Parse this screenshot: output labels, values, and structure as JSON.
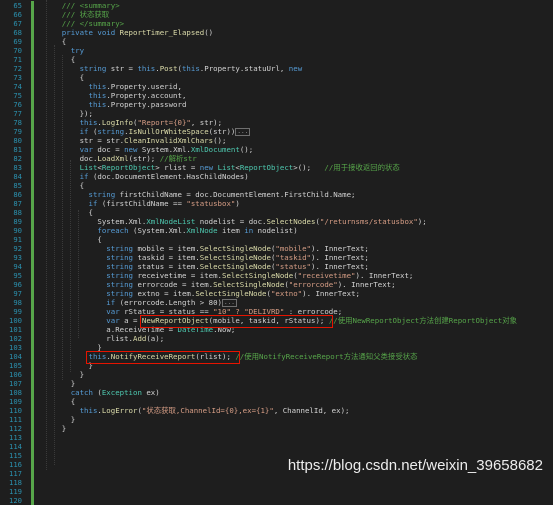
{
  "lines": [
    {
      "n": "65",
      "segs": [
        [
          "cm",
          "/// <summary>"
        ]
      ]
    },
    {
      "n": "66",
      "segs": [
        [
          "cm",
          "/// 状态获取"
        ]
      ]
    },
    {
      "n": "67",
      "segs": [
        [
          "cm",
          "/// </summary>"
        ]
      ]
    },
    {
      "n": "68",
      "segs": [
        [
          "kw",
          "private void "
        ],
        [
          "fn",
          "ReportTimer_Elapsed"
        ],
        [
          "pl",
          "()"
        ]
      ]
    },
    {
      "n": "69",
      "segs": [
        [
          "pl",
          "{"
        ]
      ]
    },
    {
      "n": "70",
      "segs": [
        [
          "kw",
          "try"
        ]
      ]
    },
    {
      "n": "71",
      "segs": [
        [
          "pl",
          "{"
        ]
      ]
    },
    {
      "n": "72",
      "segs": [
        [
          "kw",
          "string "
        ],
        [
          "pl",
          "str = "
        ],
        [
          "kw",
          "this"
        ],
        [
          "pl",
          "."
        ],
        [
          "fn",
          "Post"
        ],
        [
          "pl",
          "("
        ],
        [
          "kw",
          "this"
        ],
        [
          "pl",
          ".Property.statuUrl, "
        ],
        [
          "kw",
          "new"
        ]
      ]
    },
    {
      "n": "73",
      "segs": [
        [
          "pl",
          "{"
        ]
      ]
    },
    {
      "n": "74",
      "segs": [
        [
          "kw",
          "this"
        ],
        [
          "pl",
          ".Property.userid,"
        ]
      ]
    },
    {
      "n": "75",
      "segs": [
        [
          "kw",
          "this"
        ],
        [
          "pl",
          ".Property.account,"
        ]
      ]
    },
    {
      "n": "76",
      "segs": [
        [
          "kw",
          "this"
        ],
        [
          "pl",
          ".Property.password"
        ]
      ]
    },
    {
      "n": "77",
      "segs": [
        [
          "pl",
          "});"
        ]
      ]
    },
    {
      "n": "78",
      "segs": [
        [
          "kw",
          "this"
        ],
        [
          "pl",
          "."
        ],
        [
          "fn",
          "LogInfo"
        ],
        [
          "pl",
          "("
        ],
        [
          "st",
          "\"Report={0}\""
        ],
        [
          "pl",
          ", str);"
        ]
      ]
    },
    {
      "n": "79",
      "segs": [
        [
          "kw",
          "if "
        ],
        [
          "pl",
          "("
        ],
        [
          "kw",
          "string"
        ],
        [
          "pl",
          "."
        ],
        [
          "fn",
          "IsNullOrWhiteSpace"
        ],
        [
          "pl",
          "(str))"
        ]
      ],
      "fold": "..."
    },
    {
      "n": "80",
      "segs": [
        [
          "pl",
          "str = str."
        ],
        [
          "fn",
          "CleanInvalidXmlChars"
        ],
        [
          "pl",
          "();"
        ]
      ]
    },
    {
      "n": "81",
      "segs": [
        [
          "kw",
          "var "
        ],
        [
          "pl",
          "doc = "
        ],
        [
          "kw",
          "new "
        ],
        [
          "pl",
          "System.Xml."
        ],
        [
          "ty",
          "XmlDocument"
        ],
        [
          "pl",
          "();"
        ]
      ]
    },
    {
      "n": "82",
      "segs": [
        [
          "pl",
          "doc."
        ],
        [
          "fn",
          "LoadXml"
        ],
        [
          "pl",
          "(str); "
        ],
        [
          "cm",
          "//解析str"
        ]
      ]
    },
    {
      "n": "83",
      "segs": [
        [
          "ty",
          "List"
        ],
        [
          "pl",
          "<"
        ],
        [
          "ty",
          "ReportObject"
        ],
        [
          "pl",
          "> rlist = "
        ],
        [
          "kw",
          "new "
        ],
        [
          "ty",
          "List"
        ],
        [
          "pl",
          "<"
        ],
        [
          "ty",
          "ReportObject"
        ],
        [
          "pl",
          ">();   "
        ],
        [
          "cm",
          "//用于接收返回的状态"
        ]
      ]
    },
    {
      "n": "84",
      "segs": [
        [
          "kw",
          "if "
        ],
        [
          "pl",
          "(doc.DocumentElement.HasChildNodes)"
        ]
      ]
    },
    {
      "n": "85",
      "segs": [
        [
          "pl",
          "{"
        ]
      ]
    },
    {
      "n": "86",
      "segs": [
        [
          "kw",
          "string "
        ],
        [
          "pl",
          "firstChildName = doc.DocumentElement.FirstChild.Name;"
        ]
      ]
    },
    {
      "n": "87",
      "segs": [
        [
          "kw",
          "if "
        ],
        [
          "pl",
          "(firstChildName == "
        ],
        [
          "st",
          "\"statusbox\""
        ],
        [
          "pl",
          ")"
        ]
      ]
    },
    {
      "n": "88",
      "segs": [
        [
          "pl",
          "{"
        ]
      ]
    },
    {
      "n": "89",
      "segs": [
        [
          "pl",
          "System.Xml."
        ],
        [
          "ty",
          "XmlNodeList "
        ],
        [
          "pl",
          "nodelist = doc."
        ],
        [
          "fn",
          "SelectNodes"
        ],
        [
          "pl",
          "("
        ],
        [
          "st",
          "\"/returnsms/statusbox\""
        ],
        [
          "pl",
          ");"
        ]
      ]
    },
    {
      "n": "90",
      "segs": [
        [
          "kw",
          "foreach "
        ],
        [
          "pl",
          "(System.Xml."
        ],
        [
          "ty",
          "XmlNode "
        ],
        [
          "pl",
          "item "
        ],
        [
          "kw",
          "in "
        ],
        [
          "pl",
          "nodelist)"
        ]
      ]
    },
    {
      "n": "91",
      "segs": [
        [
          "pl",
          "{"
        ]
      ]
    },
    {
      "n": "92",
      "segs": [
        [
          "kw",
          "string "
        ],
        [
          "pl",
          "mobile = item."
        ],
        [
          "fn",
          "SelectSingleNode"
        ],
        [
          "pl",
          "("
        ],
        [
          "st",
          "\"mobile\""
        ],
        [
          "pl",
          "). InnerText;"
        ]
      ]
    },
    {
      "n": "93",
      "segs": [
        [
          "kw",
          "string "
        ],
        [
          "pl",
          "taskid = item."
        ],
        [
          "fn",
          "SelectSingleNode"
        ],
        [
          "pl",
          "("
        ],
        [
          "st",
          "\"taskid\""
        ],
        [
          "pl",
          "). InnerText;"
        ]
      ]
    },
    {
      "n": "94",
      "segs": [
        [
          "kw",
          "string "
        ],
        [
          "pl",
          "status = item."
        ],
        [
          "fn",
          "SelectSingleNode"
        ],
        [
          "pl",
          "("
        ],
        [
          "st",
          "\"status\""
        ],
        [
          "pl",
          "). InnerText;"
        ]
      ]
    },
    {
      "n": "95",
      "segs": [
        [
          "kw",
          "string "
        ],
        [
          "pl",
          "receivetime = item."
        ],
        [
          "fn",
          "SelectSingleNode"
        ],
        [
          "pl",
          "("
        ],
        [
          "st",
          "\"receivetime\""
        ],
        [
          "pl",
          "). InnerText;"
        ]
      ]
    },
    {
      "n": "96",
      "segs": [
        [
          "kw",
          "string "
        ],
        [
          "pl",
          "errorcode = item."
        ],
        [
          "fn",
          "SelectSingleNode"
        ],
        [
          "pl",
          "("
        ],
        [
          "st",
          "\"errorcode\""
        ],
        [
          "pl",
          "). InnerText;"
        ]
      ]
    },
    {
      "n": "97",
      "segs": [
        [
          "kw",
          "string "
        ],
        [
          "pl",
          "extno = item."
        ],
        [
          "fn",
          "SelectSingleNode"
        ],
        [
          "pl",
          "("
        ],
        [
          "st",
          "\"extno\""
        ],
        [
          "pl",
          "). InnerText;"
        ]
      ]
    },
    {
      "n": "98",
      "segs": [
        [
          "kw",
          "if "
        ],
        [
          "pl",
          "(errorcode.Length > 80)"
        ]
      ],
      "fold": "..."
    },
    {
      "n": "99",
      "segs": [
        [
          "kw",
          "var "
        ],
        [
          "pl",
          "rStatus = status == "
        ],
        [
          "st",
          "\"10\" ? \"DELIVRD\""
        ],
        [
          "pl",
          " : errorcode;"
        ]
      ]
    },
    {
      "n": "100",
      "segs": [
        [
          "kw",
          "var "
        ],
        [
          "pl",
          "a = "
        ],
        [
          "fn",
          "NewReportObject"
        ],
        [
          "pl",
          "(mobile, taskid, rStatus); "
        ],
        [
          "cm",
          "//使用NewReportObject方法创建ReportObject对象"
        ]
      ]
    },
    {
      "n": "101",
      "segs": [
        [
          "pl",
          "a.ReceiveTime = "
        ],
        [
          "ty",
          "DateTime"
        ],
        [
          "pl",
          ".Now;"
        ]
      ]
    },
    {
      "n": "102",
      "segs": [
        [
          "pl",
          "rlist."
        ],
        [
          "fn",
          "Add"
        ],
        [
          "pl",
          "(a);"
        ]
      ]
    },
    {
      "n": "103",
      "segs": [
        [
          "pl",
          "}"
        ]
      ]
    },
    {
      "n": "104",
      "segs": [
        [
          "kw",
          "this"
        ],
        [
          "pl",
          "."
        ],
        [
          "fn",
          "NotifyReceiveReport"
        ],
        [
          "pl",
          "(rlist); "
        ],
        [
          "cm",
          "//使用NotifyReceiveReport方法通知父类接受状态"
        ]
      ]
    },
    {
      "n": "105",
      "segs": [
        [
          "pl",
          "}"
        ]
      ]
    },
    {
      "n": "106",
      "segs": [
        [
          "pl",
          "}"
        ]
      ]
    },
    {
      "n": "107",
      "segs": [
        [
          "pl",
          "}"
        ]
      ]
    },
    {
      "n": "108",
      "segs": [
        [
          "kw",
          "catch "
        ],
        [
          "pl",
          "("
        ],
        [
          "ty",
          "Exception "
        ],
        [
          "pl",
          "ex)"
        ]
      ]
    },
    {
      "n": "109",
      "segs": [
        [
          "pl",
          "{"
        ]
      ]
    },
    {
      "n": "110",
      "segs": [
        [
          "kw",
          "this"
        ],
        [
          "pl",
          "."
        ],
        [
          "fn",
          "LogError"
        ],
        [
          "pl",
          "("
        ],
        [
          "st",
          "\"状态获取,ChannelId={0},ex={1}\""
        ],
        [
          "pl",
          ", ChannelId, ex);"
        ]
      ]
    },
    {
      "n": "111",
      "segs": [
        [
          "pl",
          "}"
        ]
      ]
    },
    {
      "n": "112",
      "segs": [
        [
          "pl",
          "}"
        ]
      ]
    }
  ],
  "gutter_numbers": [
    "65",
    "66",
    "67",
    "68",
    "69",
    "70",
    "71",
    "72",
    "73",
    "74",
    "75",
    "76",
    "77",
    "78",
    "79",
    "80",
    "81",
    "82",
    "83",
    "84",
    "85",
    "86",
    "87",
    "88",
    "89",
    "90",
    "91",
    "92",
    "93",
    "94",
    "95",
    "96",
    "97",
    "98",
    "99",
    "100",
    "101",
    "102",
    "103",
    "104",
    "105",
    "106",
    "107",
    "108",
    "109",
    "110",
    "111",
    "112",
    "113",
    "114",
    "115",
    "116",
    "117",
    "118",
    "119",
    "120"
  ],
  "watermark": "https://blog.csdn.net/weixin_39658682",
  "colors": {
    "background": "#1e1e1e",
    "keyword": "#569cd6",
    "type": "#4ec9b0",
    "string": "#d69d85",
    "comment": "#57a64a",
    "method": "#dcdcaa",
    "line_number": "#2b91af",
    "highlight_box": "#e51400"
  }
}
